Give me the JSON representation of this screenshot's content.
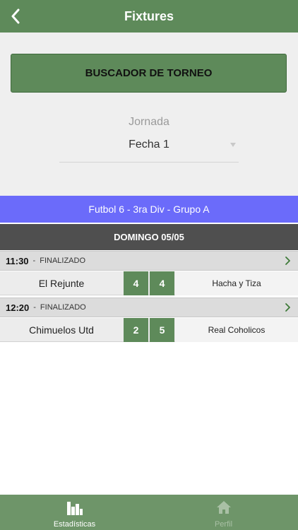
{
  "nav": {
    "title": "Fixtures",
    "back_icon": "chevron-left-icon"
  },
  "filter": {
    "search_button_label": "BUSCADOR DE TORNEO",
    "jornada_label": "Jornada",
    "jornada_value": "Fecha 1"
  },
  "tournament": {
    "name": "Futbol 6 - 3ra Div - Grupo A"
  },
  "day": {
    "label": "DOMINGO 05/05"
  },
  "matches": [
    {
      "time": "11:30",
      "separator": "-",
      "status": "FINALIZADO",
      "home": "El Rejunte",
      "home_score": "4",
      "away_score": "4",
      "away": "Hacha y Tiza"
    },
    {
      "time": "12:20",
      "separator": "-",
      "status": "FINALIZADO",
      "home": "Chimuelos Utd",
      "home_score": "2",
      "away_score": "5",
      "away": "Real Coholicos"
    }
  ],
  "tabbar": {
    "items": [
      {
        "label": "Estadísticas",
        "icon": "bar-chart-icon",
        "active": true
      },
      {
        "label": "Perfil",
        "icon": "home-icon",
        "active": false
      }
    ]
  },
  "colors": {
    "primary_green": "#5e8a5a",
    "tournament_blue": "#6b6bfa",
    "day_bar_gray": "#4f4f4f"
  }
}
